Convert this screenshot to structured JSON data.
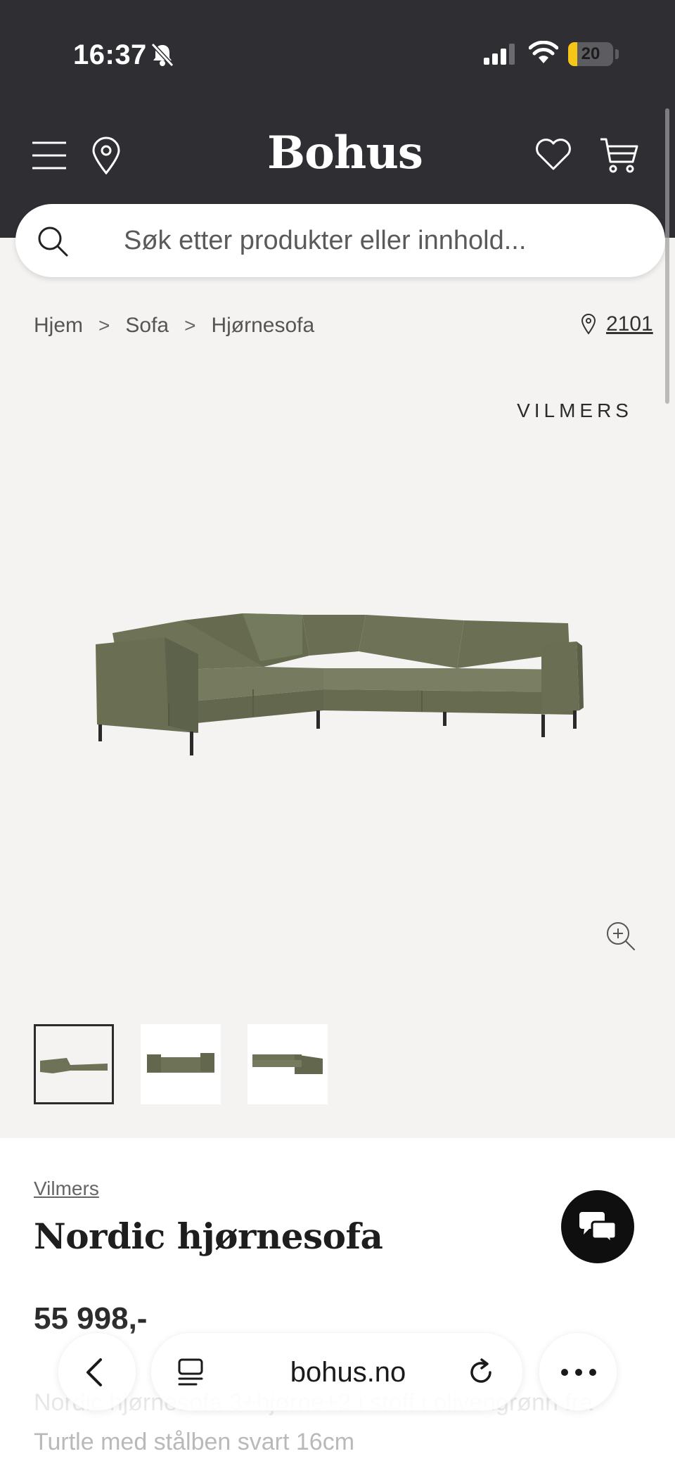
{
  "status_bar": {
    "time": "16:37",
    "battery": "20",
    "battery_level": 0.2
  },
  "header": {
    "logo": "Bohus",
    "icons": [
      "menu-icon",
      "location-pin-icon",
      "heart-icon",
      "cart-icon"
    ]
  },
  "search": {
    "placeholder": "Søk etter produkter eller innhold..."
  },
  "breadcrumb": {
    "items": [
      "Hjem",
      "Sofa",
      "Hjørnesofa"
    ],
    "separator": ">"
  },
  "store": {
    "code": "2101"
  },
  "product": {
    "brand_mark": "VILMERS",
    "brand_link": "Vilmers",
    "title": "Nordic hjørnesofa",
    "price": "55 998,-",
    "description": "Nordic hjørnesofa 3+hjørne+2 i stoff i olivengrønn fra Turtle med stålben svart 16cm",
    "thumbnails_count": 3,
    "sofa_color": "#6e7358"
  },
  "browser": {
    "url": "bohus.no"
  },
  "colors": {
    "header_bg": "#2f2e33",
    "page_bg": "#f4f3f1",
    "battery": "#f5c518"
  }
}
